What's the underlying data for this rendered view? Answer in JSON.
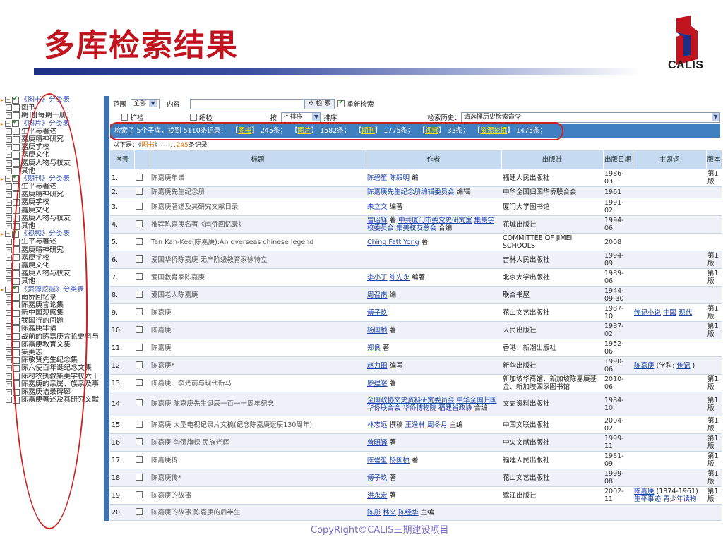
{
  "slide": {
    "title": "多库检索结果",
    "logo_text": "CALIS",
    "footer": "CopyRight©CALIS三期建设项目"
  },
  "colors": {
    "title_red": "#c0141e",
    "blue_bar": "#3f7fc0",
    "header_blue": "#c6daf1",
    "oval_red": "#d21e1e"
  },
  "left_panel": {
    "groups": [
      {
        "label": "《图书》分类表",
        "checked": true,
        "items": [
          "图书",
          "期刊[每期一册]"
        ]
      },
      {
        "label": "《图片》分类表",
        "checked": true,
        "items": [
          "生平与著述",
          "嘉庚精神研究",
          "嘉庚学校",
          "嘉庚文化",
          "嘉庚人物与校友",
          "其他"
        ]
      },
      {
        "label": "《期刊》分类表",
        "checked": true,
        "items": [
          "生平与著述",
          "嘉庚精神研究",
          "嘉庚学校",
          "嘉庚文化",
          "嘉庚人物与校友",
          "其他"
        ]
      },
      {
        "label": "《视频》分类表",
        "checked": true,
        "items": [
          "生平与著述",
          "嘉庚精神研究",
          "嘉庚学校",
          "嘉庚文化",
          "嘉庚人物与校友",
          "其他"
        ]
      },
      {
        "label": "《资源挖掘》分类表",
        "checked": true,
        "items": [
          "南侨回忆录",
          "陈嘉庚言论集",
          "新中国观感集",
          "我国行的问题",
          "陈嘉庚年谱",
          "战前的陈嘉庚言论史料与",
          "陈嘉庚教育文集",
          "集美志",
          "陈敬贤先生纪念集",
          "陈六使百年诞纪念文集",
          "陈村牧执教集美学校六十",
          "陈嘉庚的亲属、族亲及事",
          "陈嘉庚语录碑廊",
          "陈嘉庚著述及其研究文献"
        ]
      }
    ]
  },
  "search": {
    "range_label": "范围",
    "range_value": "全部",
    "content_label": "内容",
    "search_button": "检 索",
    "re_search_label": "重新检索",
    "expand_label": "扩检",
    "narrow_label": "缩检",
    "sort_by_label": "按",
    "sort_value": "不排序",
    "sort_suffix": "排序",
    "history_label": "检索历史：",
    "history_value": "请选择历史检索命令"
  },
  "summary": {
    "prefix": "检索了 5个子库，找到 5110条记录：",
    "items": [
      {
        "name": "图书",
        "count": "245条；"
      },
      {
        "name": "图片",
        "count": "1582条；"
      },
      {
        "name": "期刊",
        "count": "1775条；"
      },
      {
        "name": "视频",
        "count": "33条；"
      },
      {
        "name": "资源挖掘",
        "count": "1475条；"
      }
    ]
  },
  "sub_bar": {
    "prefix": "以下是：《",
    "db": "图书",
    "mid": "》----共",
    "count": "245",
    "suffix": "条记录"
  },
  "table": {
    "headers": [
      "序号",
      "",
      "标题",
      "作者",
      "出版社",
      "出版日期",
      "主题词",
      "版本"
    ],
    "rows": [
      {
        "no": "1.",
        "title": "陈嘉庚年谱",
        "authors": [
          {
            "t": "陈碧笙",
            "link": true
          },
          {
            "t": " ",
            "link": false
          },
          {
            "t": "陈毅明",
            "link": true
          },
          {
            "t": " 编",
            "link": false
          }
        ],
        "pub": "福建人民出版社",
        "date": "1986-03",
        "subjects": [],
        "ed": "第1版"
      },
      {
        "no": "2.",
        "title": "陈嘉庚先生纪念册",
        "authors": [
          {
            "t": "陈嘉庚先生纪念册编辑委员会",
            "link": true
          },
          {
            "t": " 编辑",
            "link": false
          }
        ],
        "pub": "中华全国归国华侨联合会",
        "date": "1961",
        "subjects": [],
        "ed": ""
      },
      {
        "no": "3.",
        "title": "陈嘉庚著述及其研究文献目录",
        "authors": [
          {
            "t": "朱立文",
            "link": true
          },
          {
            "t": " 编著",
            "link": false
          }
        ],
        "pub": "厦门大学图书馆",
        "date": "1991-02",
        "subjects": [],
        "ed": ""
      },
      {
        "no": "4.",
        "title": "推荐陈嘉庚名著《南侨回忆录》",
        "authors": [
          {
            "t": "曾昭铎",
            "link": true
          },
          {
            "t": " 著 ",
            "link": false
          },
          {
            "t": "中共厦门市委党史研究室",
            "link": true
          },
          {
            "t": " ",
            "link": false
          },
          {
            "t": "集美学校委员会",
            "link": true
          },
          {
            "t": " ",
            "link": false
          },
          {
            "t": "集美校友总会",
            "link": true
          },
          {
            "t": " 合编",
            "link": false
          }
        ],
        "pub": "花城出版社",
        "date": "1994-06",
        "subjects": [],
        "ed": ""
      },
      {
        "no": "5.",
        "title": "Tan Kah-Kee(陈嘉庚):An overseas chinese legend",
        "authors": [
          {
            "t": "Ching Fatt Yong",
            "link": true
          },
          {
            "t": " 著",
            "link": false
          }
        ],
        "pub": "COMMITTEE OF JIMEI SCHOOLS",
        "date": "2008",
        "subjects": [],
        "ed": ""
      },
      {
        "no": "6.",
        "title": "爱国华侨陈嘉庚 无产阶级教育家徐特立",
        "authors": [],
        "pub": "吉林人民出版社",
        "date": "1994-09",
        "subjects": [],
        "ed": "第1版"
      },
      {
        "no": "7.",
        "title": "爱国教育家陈嘉庚",
        "authors": [
          {
            "t": "李小丁",
            "link": true
          },
          {
            "t": " ",
            "link": false
          },
          {
            "t": "练先永",
            "link": true
          },
          {
            "t": " 编著",
            "link": false
          }
        ],
        "pub": "北京大学出版社",
        "date": "1989-06",
        "subjects": [],
        "ed": "第1版"
      },
      {
        "no": "8.",
        "title": "爱国老人陈嘉庚",
        "authors": [
          {
            "t": "周召南",
            "link": true
          },
          {
            "t": " 编",
            "link": false
          }
        ],
        "pub": "联合书屋",
        "date": "1944-09-30",
        "subjects": [],
        "ed": ""
      },
      {
        "no": "9.",
        "title": "陈嘉庚",
        "authors": [
          {
            "t": "傅子玖",
            "link": true
          }
        ],
        "pub": "花山文艺出版社",
        "date": "1987-10",
        "subjects": [
          {
            "t": "传记小说",
            "link": true
          },
          {
            "t": " ",
            "link": false
          },
          {
            "t": "中国",
            "link": true
          },
          {
            "t": " ",
            "link": false
          },
          {
            "t": "现代",
            "link": true
          }
        ],
        "ed": "第1版"
      },
      {
        "no": "10.",
        "title": "陈嘉庚",
        "authors": [
          {
            "t": "杨国桢",
            "link": true
          },
          {
            "t": " 著",
            "link": false
          }
        ],
        "pub": "人民出版社",
        "date": "1987-02",
        "subjects": [],
        "ed": "第1版"
      },
      {
        "no": "11.",
        "title": "陈嘉庚",
        "authors": [
          {
            "t": "郑良",
            "link": true
          },
          {
            "t": " 著",
            "link": false
          }
        ],
        "pub": "香港：新潮出版社",
        "date": "1952-06",
        "subjects": [],
        "ed": ""
      },
      {
        "no": "12.",
        "title": "陈嘉庚*",
        "authors": [
          {
            "t": "赵力田",
            "link": true
          },
          {
            "t": " 编写",
            "link": false
          }
        ],
        "pub": "新华出版社",
        "date": "1990-06",
        "subjects": [
          {
            "t": "陈嘉庚",
            "link": true
          },
          {
            "t": " (学科: ",
            "link": false
          },
          {
            "t": "传记",
            "link": true
          },
          {
            "t": " )",
            "link": false
          }
        ],
        "ed": ""
      },
      {
        "no": "13.",
        "title": "陈嘉庚、李光前与现代新马",
        "authors": [
          {
            "t": "廖建裕",
            "link": true
          },
          {
            "t": " 著",
            "link": false
          }
        ],
        "pub": "新加坡华裔馆、新加坡陈嘉庚基金、新加坡国家图书馆",
        "date": "2010-06",
        "subjects": [],
        "ed": "第1版"
      },
      {
        "no": "14.",
        "title": "陈嘉庚 陈嘉庚先生诞辰一百一十周年纪念",
        "authors": [
          {
            "t": "全国政协文史资料研究委员会",
            "link": true
          },
          {
            "t": " ",
            "link": false
          },
          {
            "t": "中华全国归国华侨联合会",
            "link": true
          },
          {
            "t": " ",
            "link": false
          },
          {
            "t": "华侨博物院",
            "link": true
          },
          {
            "t": " ",
            "link": false
          },
          {
            "t": "福建省政协",
            "link": true
          },
          {
            "t": " 合编",
            "link": false
          }
        ],
        "pub": "文史资料出版社",
        "date": "1984-10",
        "subjects": [],
        "ed": "第1版"
      },
      {
        "no": "15.",
        "title": "陈嘉庚 大型电视纪录片文稿(纪念陈嘉庚诞辰130周年)",
        "authors": [
          {
            "t": "林志远",
            "link": true
          },
          {
            "t": " 撰稿 ",
            "link": false
          },
          {
            "t": "王逸林",
            "link": true
          },
          {
            "t": " ",
            "link": false
          },
          {
            "t": "周冬月",
            "link": true
          },
          {
            "t": " 主编",
            "link": false
          }
        ],
        "pub": "中国文联出版社",
        "date": "2004-02",
        "subjects": [],
        "ed": "第1版"
      },
      {
        "no": "16.",
        "title": "陈嘉庚 华侨旗帜 民族光辉",
        "authors": [
          {
            "t": "曾昭铎",
            "link": true
          },
          {
            "t": " 著",
            "link": false
          }
        ],
        "pub": "中央文献出版社",
        "date": "1999-11",
        "subjects": [],
        "ed": "第1版"
      },
      {
        "no": "17.",
        "title": "陈嘉庚传",
        "authors": [
          {
            "t": "陈碧笙",
            "link": true
          },
          {
            "t": " ",
            "link": false
          },
          {
            "t": "杨国桢",
            "link": true
          },
          {
            "t": " 著",
            "link": false
          }
        ],
        "pub": "福建人民出版社",
        "date": "1981-09",
        "subjects": [],
        "ed": "第1版"
      },
      {
        "no": "18.",
        "title": "陈嘉庚传*",
        "authors": [
          {
            "t": "傅子玖",
            "link": true
          },
          {
            "t": " 著",
            "link": false
          }
        ],
        "pub": "花山文艺出版社",
        "date": "1999-08",
        "subjects": [],
        "ed": "第1版"
      },
      {
        "no": "19.",
        "title": "陈嘉庚的故事",
        "authors": [
          {
            "t": "洪永宏",
            "link": true
          },
          {
            "t": " 著",
            "link": false
          }
        ],
        "pub": "鹭江出版社",
        "date": "2002-11",
        "subjects": [
          {
            "t": "陈嘉庚",
            "link": true
          },
          {
            "t": " (1874-1961) ",
            "link": false
          },
          {
            "t": "生平事迹",
            "link": true
          },
          {
            "t": " ",
            "link": false
          },
          {
            "t": "青少年读物",
            "link": true
          }
        ],
        "ed": "第1版"
      },
      {
        "no": "20.",
        "title": "陈嘉庚的故事 陈嘉庚的后半生",
        "authors": [
          {
            "t": "陈彤",
            "link": true
          },
          {
            "t": " ",
            "link": false
          },
          {
            "t": "林义",
            "link": true
          },
          {
            "t": " ",
            "link": false
          },
          {
            "t": "陈经华",
            "link": true
          },
          {
            "t": " 主编",
            "link": false
          }
        ],
        "pub": "",
        "date": "",
        "subjects": [],
        "ed": ""
      }
    ]
  }
}
